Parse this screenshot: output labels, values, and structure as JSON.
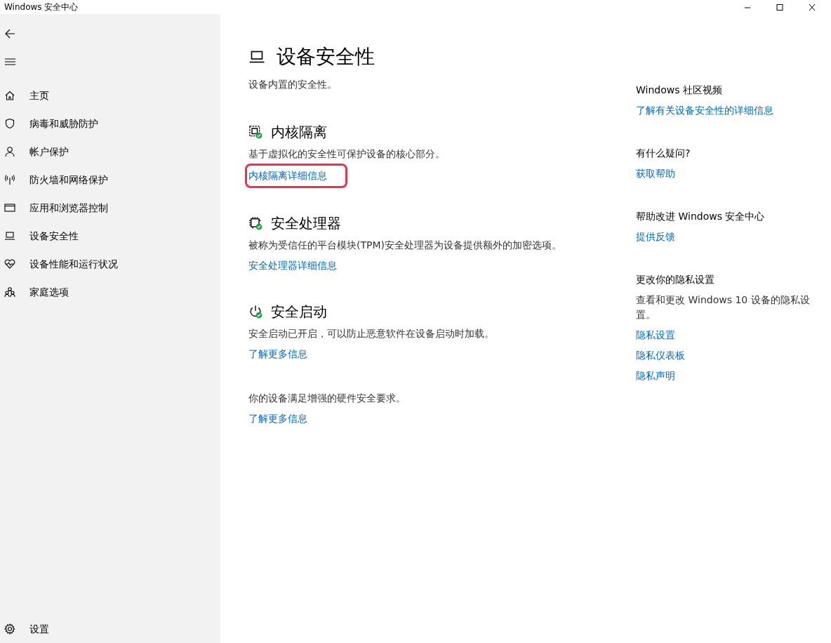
{
  "window": {
    "title": "Windows 安全中心"
  },
  "sidebar": {
    "items": [
      {
        "label": "主页",
        "selected": false
      },
      {
        "label": "病毒和威胁防护",
        "selected": false
      },
      {
        "label": "帐户保护",
        "selected": false
      },
      {
        "label": "防火墙和网络保护",
        "selected": false
      },
      {
        "label": "应用和浏览器控制",
        "selected": false
      },
      {
        "label": "设备安全性",
        "selected": false
      },
      {
        "label": "设备性能和运行状况",
        "selected": false
      },
      {
        "label": "家庭选项",
        "selected": false
      }
    ],
    "settings": {
      "label": "设置"
    }
  },
  "page": {
    "title": "设备安全性",
    "subtitle": "设备内置的安全性。",
    "sections": [
      {
        "title": "内核隔离",
        "description": "基于虚拟化的安全性可保护设备的核心部分。",
        "link": "内核隔离详细信息",
        "outlined": true
      },
      {
        "title": "安全处理器",
        "description": "被称为受信任的平台模块(TPM)安全处理器为设备提供额外的加密选项。",
        "link": "安全处理器详细信息",
        "outlined": false
      },
      {
        "title": "安全启动",
        "description": "安全启动已开启，可以防止恶意软件在设备启动时加载。",
        "link": "了解更多信息",
        "outlined": false
      },
      {
        "description": "你的设备满足增强的硬件安全要求。",
        "link": "了解更多信息",
        "outlined": false
      }
    ]
  },
  "aside": [
    {
      "heading": "Windows 社区视频",
      "links": [
        "了解有关设备安全性的详细信息"
      ]
    },
    {
      "heading": "有什么疑问?",
      "links": [
        "获取帮助"
      ]
    },
    {
      "heading": "帮助改进 Windows 安全中心",
      "links": [
        "提供反馈"
      ]
    },
    {
      "heading": "更改你的隐私设置",
      "text": "查看和更改 Windows 10 设备的隐私设置。",
      "links": [
        "隐私设置",
        "隐私仪表板",
        "隐私声明"
      ]
    }
  ]
}
